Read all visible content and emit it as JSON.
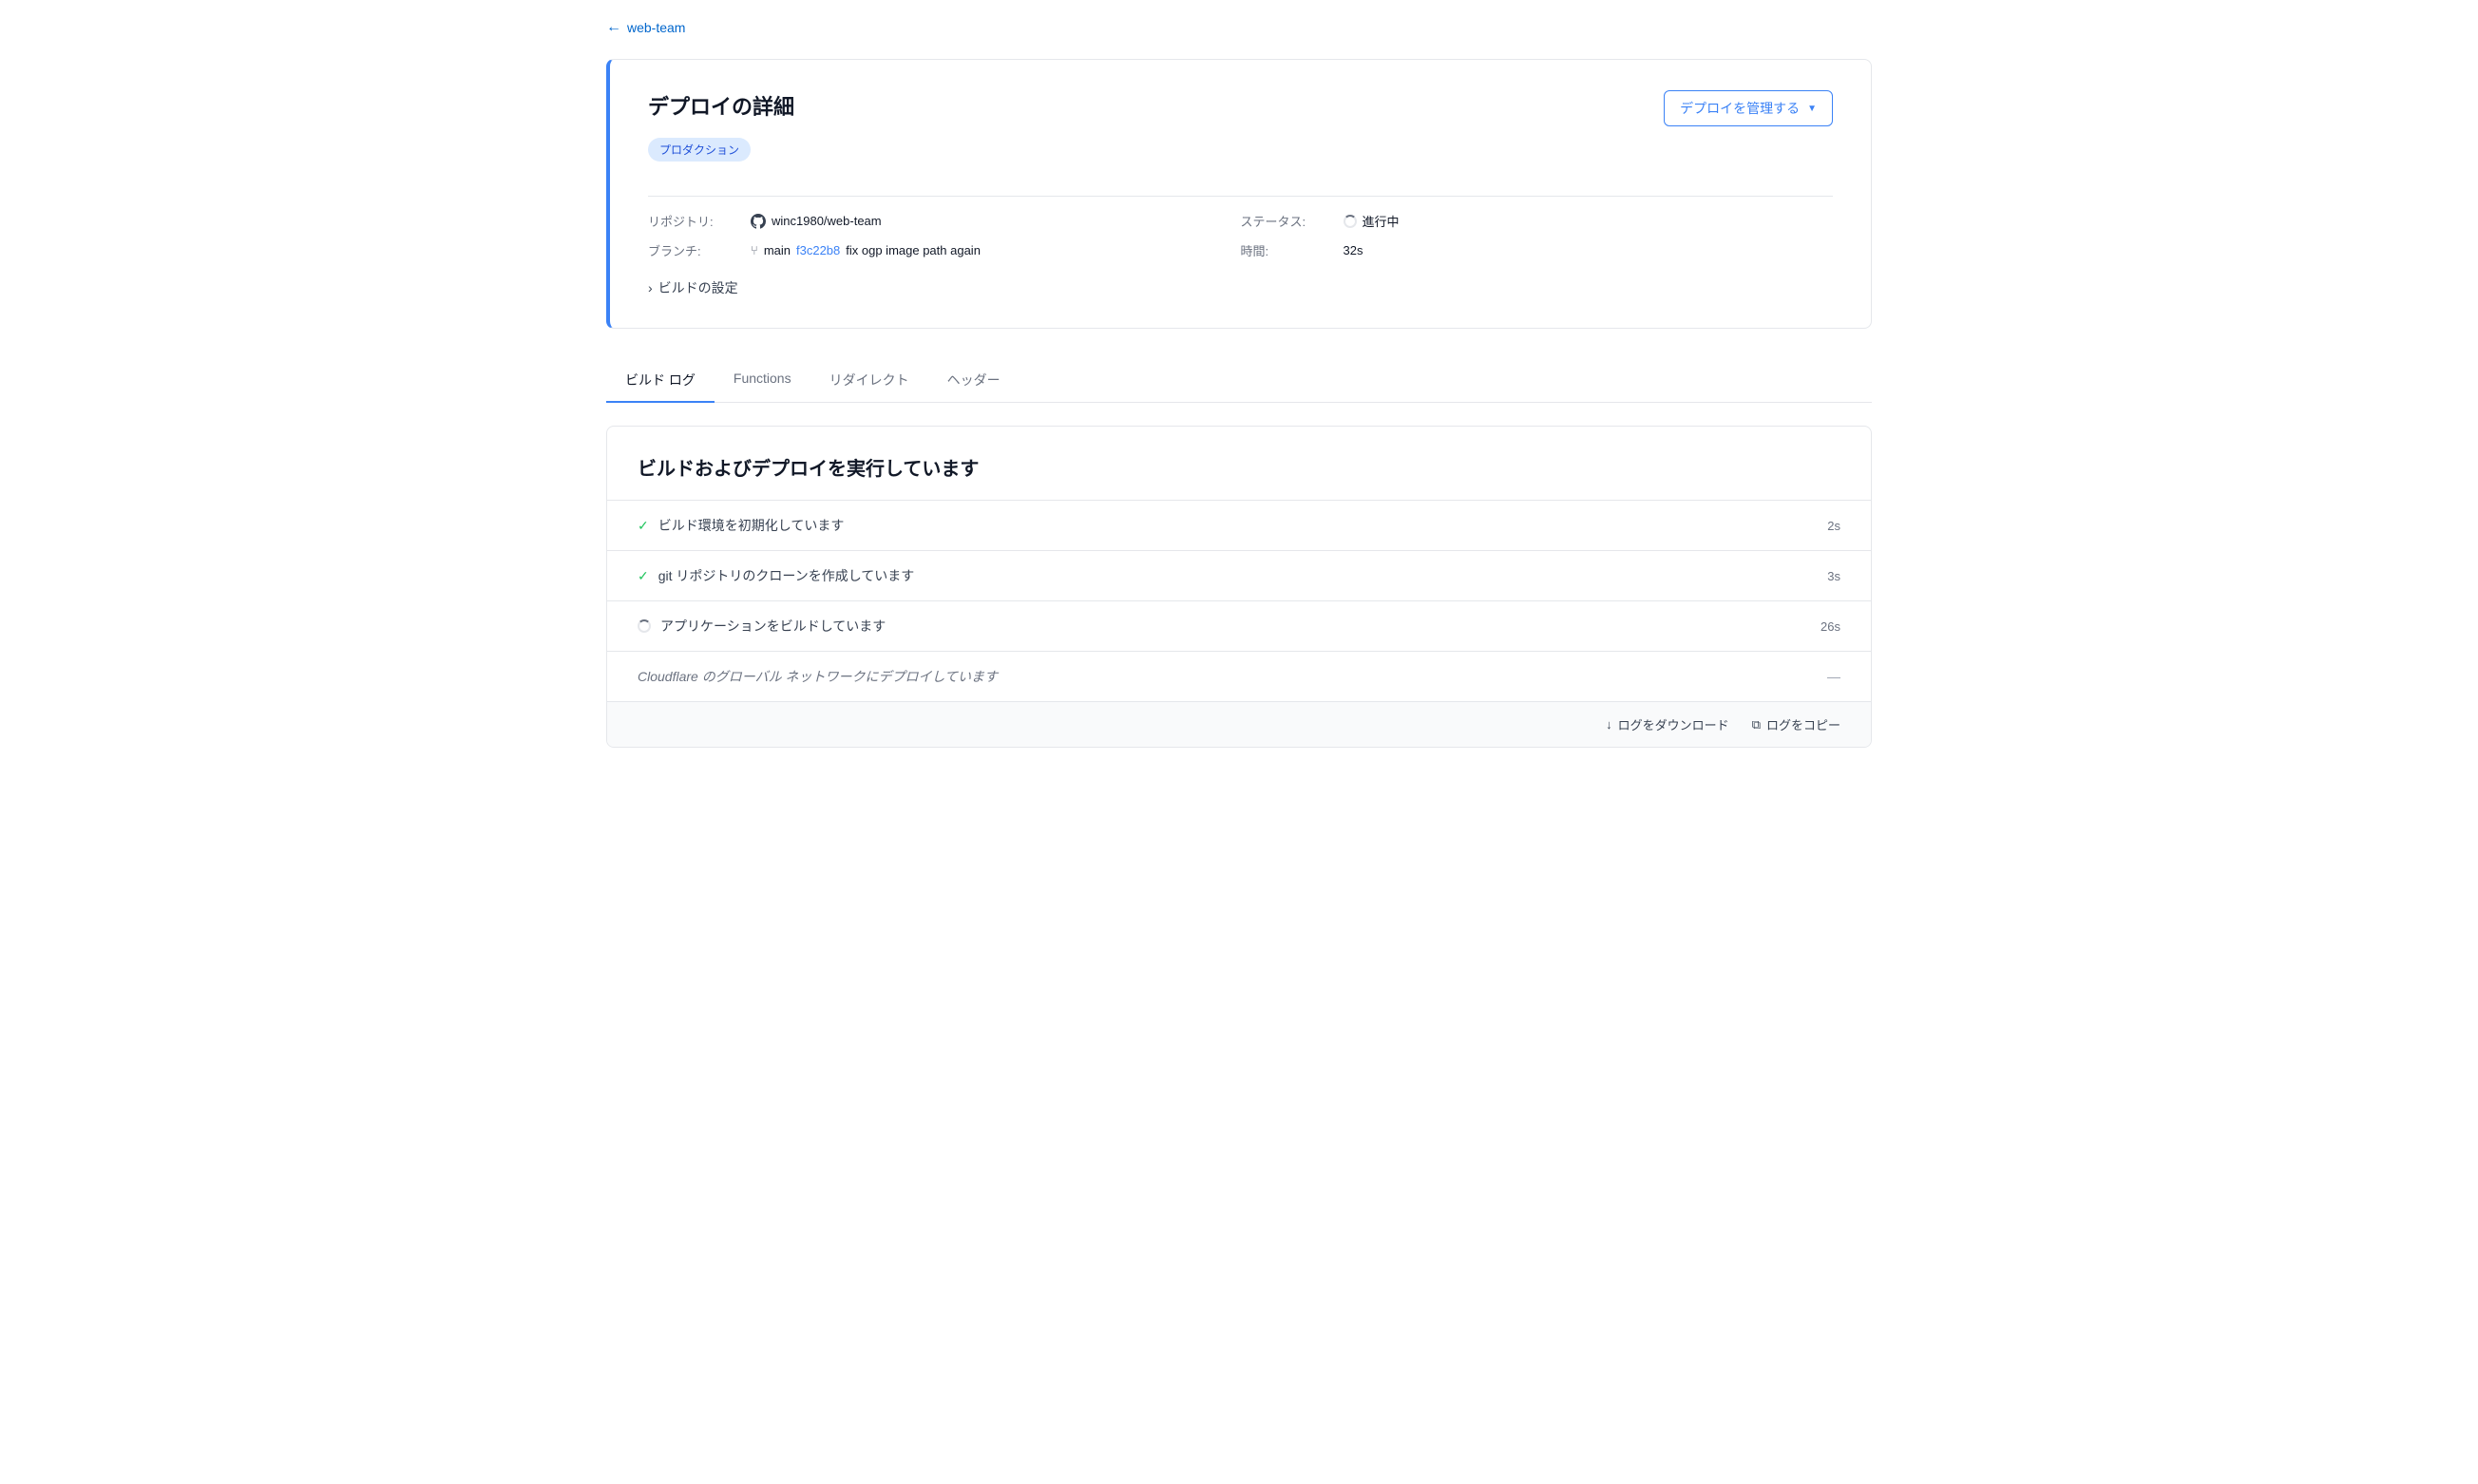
{
  "back_link": {
    "label": "web-team",
    "arrow": "←"
  },
  "deploy_card": {
    "title": "デプロイの詳細",
    "manage_button": "デプロイを管理する",
    "badge": "プロダクション",
    "repo_label": "リポジトリ:",
    "repo_value": "winc1980/web-team",
    "branch_label": "ブランチ:",
    "branch_value": "main",
    "commit_hash": "f3c22b8",
    "commit_message": "fix ogp image path again",
    "status_label": "ステータス:",
    "status_value": "進行中",
    "time_label": "時間:",
    "time_value": "32s",
    "build_settings": "ビルドの設定"
  },
  "tabs": [
    {
      "id": "build-log",
      "label": "ビルド ログ",
      "active": true
    },
    {
      "id": "functions",
      "label": "Functions",
      "active": false
    },
    {
      "id": "redirects",
      "label": "リダイレクト",
      "active": false
    },
    {
      "id": "headers",
      "label": "ヘッダー",
      "active": false
    }
  ],
  "build_log": {
    "title": "ビルドおよびデプロイを実行しています",
    "steps": [
      {
        "type": "check",
        "text": "ビルド環境を初期化しています",
        "time": "2s"
      },
      {
        "type": "check",
        "text": "git リポジトリのクローンを作成しています",
        "time": "3s"
      },
      {
        "type": "spinner",
        "text": "アプリケーションをビルドしています",
        "time": "26s"
      },
      {
        "type": "pending",
        "text": "Cloudflare のグローバル ネットワークにデプロイしています",
        "time": "—"
      }
    ],
    "footer": {
      "download": "ログをダウンロード",
      "copy": "ログをコピー"
    }
  }
}
